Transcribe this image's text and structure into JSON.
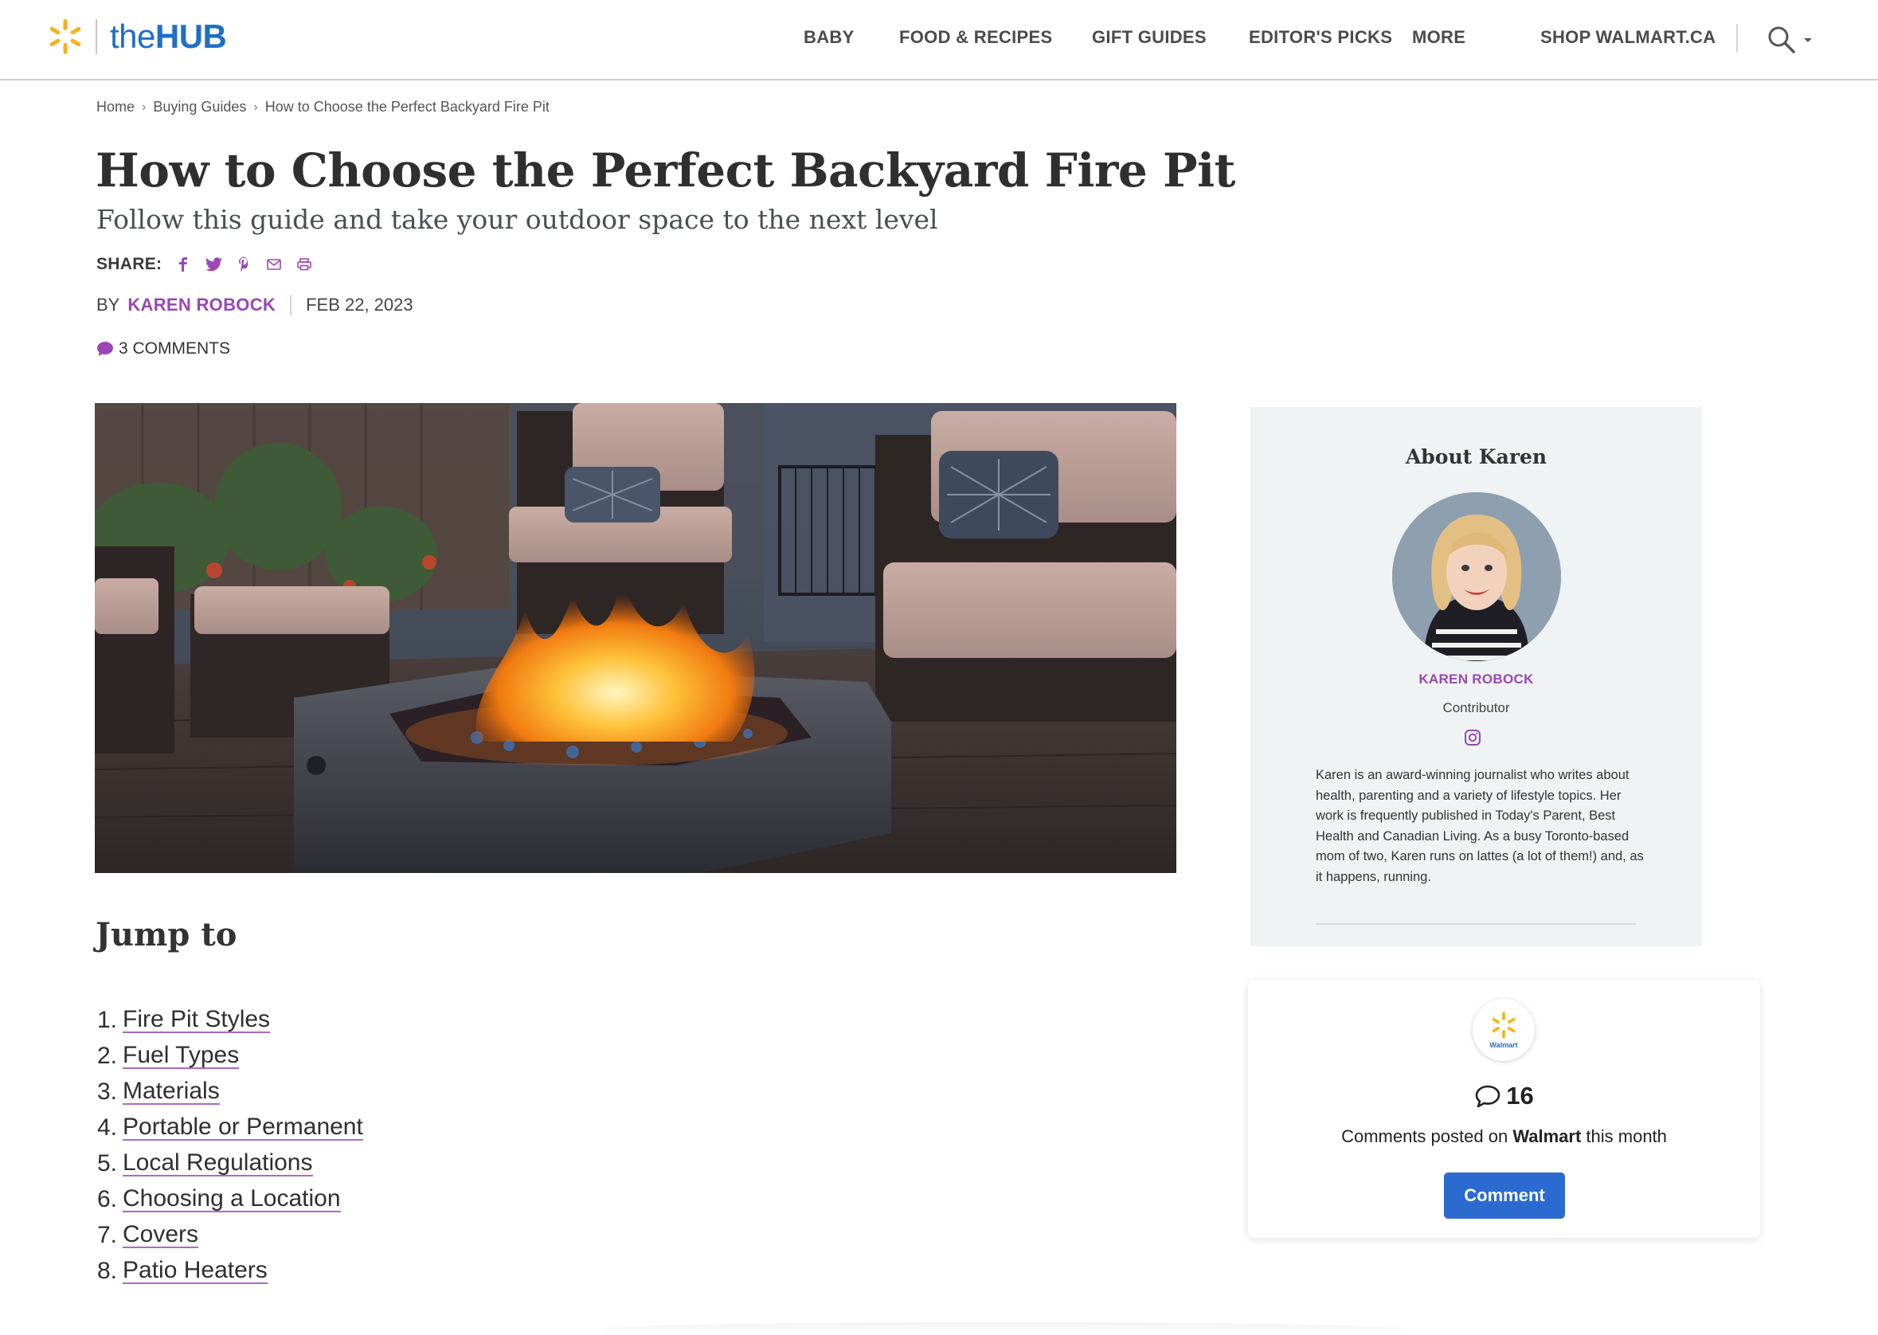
{
  "header": {
    "logo": {
      "prefix": "the",
      "brand": "HUB"
    },
    "nav": [
      "BABY",
      "FOOD & RECIPES",
      "GIFT GUIDES",
      "EDITOR'S PICKS",
      "MORE",
      "SHOP WALMART.CA"
    ]
  },
  "breadcrumb": [
    "Home",
    "Buying Guides",
    "How to Choose the Perfect Backyard Fire Pit"
  ],
  "article": {
    "title": "How to Choose the Perfect Backyard Fire Pit",
    "subtitle": "Follow this guide and take your outdoor space to the next level",
    "share_label": "SHARE:",
    "share_icons": [
      "facebook-icon",
      "twitter-icon",
      "pinterest-icon",
      "email-icon",
      "print-icon"
    ],
    "by_label": "BY",
    "author": "KAREN ROBOCK",
    "date": "FEB 22, 2023",
    "comments": "3 COMMENTS"
  },
  "jump_to": {
    "title": "Jump to",
    "items": [
      {
        "num": "1.",
        "label": "Fire Pit Styles"
      },
      {
        "num": "2.",
        "label": "Fuel Types"
      },
      {
        "num": "3.",
        "label": "Materials"
      },
      {
        "num": "4.",
        "label": "Portable or Permanent"
      },
      {
        "num": "5.",
        "label": "Local Regulations"
      },
      {
        "num": "6.",
        "label": "Choosing a Location"
      },
      {
        "num": "7.",
        "label": "Covers"
      },
      {
        "num": "8.",
        "label": "Patio Heaters"
      }
    ]
  },
  "about": {
    "title": "About Karen",
    "name": "KAREN ROBOCK",
    "role": "Contributor",
    "bio": "Karen is an award-winning journalist who writes about health, parenting and a variety of lifestyle topics. Her work is frequently published in Today's Parent, Best Health and Canadian Living. As a busy Toronto-based mom of two, Karen runs on lattes (a lot of them!) and, as it happens, running."
  },
  "comment_widget": {
    "logo_text": "Walmart",
    "count": "16",
    "text_before": "Comments posted on ",
    "text_brand": "Walmart",
    "text_after": " this month",
    "button": "Comment"
  },
  "colors": {
    "brand_blue": "#1f6fc5",
    "accent_purple": "#9a46b5",
    "spark_yellow": "#f5b21b",
    "button_blue": "#2b6bcf"
  }
}
